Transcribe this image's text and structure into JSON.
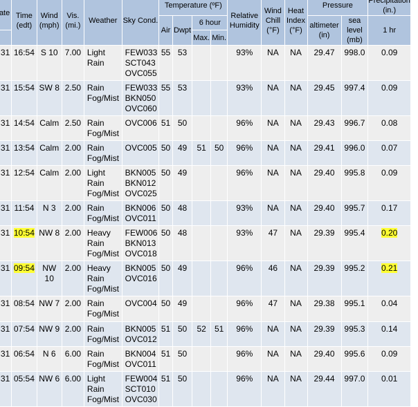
{
  "headers": {
    "date": "Date",
    "time": "Time (edt)",
    "wind": "Wind (mph)",
    "vis": "Vis. (mi.)",
    "weather": "Weather",
    "sky": "Sky Cond.",
    "temp": "Temperature (ºF)",
    "air": "Air",
    "dwpt": "Dwpt",
    "six_hour": "6 hour",
    "max": "Max.",
    "min": "Min.",
    "rh": "Relative Humidity",
    "wind_chill": "Wind Chill (°F)",
    "heat_index": "Heat Index (°F)",
    "pressure": "Pressure",
    "altimeter": "altimeter (in)",
    "sea_level": "sea level (mb)",
    "precip": "Precipitation (in.)",
    "one_hr": "1 hr"
  },
  "rows": [
    {
      "date": "31",
      "time": "16:54",
      "wind": "S 10",
      "vis": "7.00",
      "weather": [
        "Light",
        "Rain"
      ],
      "sky": [
        "FEW033",
        "SCT043",
        "OVC055"
      ],
      "air": "55",
      "dwpt": "53",
      "max": "",
      "min": "",
      "rh": "93%",
      "chill": "NA",
      "heat": "NA",
      "alt": "29.47",
      "sea": "998.0",
      "hr1": "0.09",
      "time_hl": false,
      "hr1_hl": false
    },
    {
      "date": "31",
      "time": "15:54",
      "wind": "SW 8",
      "vis": "2.50",
      "weather": [
        "Rain",
        "Fog/Mist"
      ],
      "sky": [
        "FEW033",
        "BKN050",
        "OVC060"
      ],
      "air": "55",
      "dwpt": "53",
      "max": "",
      "min": "",
      "rh": "93%",
      "chill": "NA",
      "heat": "NA",
      "alt": "29.45",
      "sea": "997.4",
      "hr1": "0.09",
      "time_hl": false,
      "hr1_hl": false
    },
    {
      "date": "31",
      "time": "14:54",
      "wind": "Calm",
      "vis": "2.50",
      "weather": [
        "Rain",
        "Fog/Mist"
      ],
      "sky": [
        "OVC006"
      ],
      "air": "51",
      "dwpt": "50",
      "max": "",
      "min": "",
      "rh": "96%",
      "chill": "NA",
      "heat": "NA",
      "alt": "29.43",
      "sea": "996.7",
      "hr1": "0.08",
      "time_hl": false,
      "hr1_hl": false
    },
    {
      "date": "31",
      "time": "13:54",
      "wind": "Calm",
      "vis": "2.00",
      "weather": [
        "Rain",
        "Fog/Mist"
      ],
      "sky": [
        "OVC005"
      ],
      "air": "50",
      "dwpt": "49",
      "max": "51",
      "min": "50",
      "rh": "96%",
      "chill": "NA",
      "heat": "NA",
      "alt": "29.41",
      "sea": "996.0",
      "hr1": "0.07",
      "time_hl": false,
      "hr1_hl": false
    },
    {
      "date": "31",
      "time": "12:54",
      "wind": "Calm",
      "vis": "2.00",
      "weather": [
        "Light",
        "Rain",
        "Fog/Mist"
      ],
      "sky": [
        "BKN005",
        "BKN012",
        "OVC025"
      ],
      "air": "50",
      "dwpt": "49",
      "max": "",
      "min": "",
      "rh": "96%",
      "chill": "NA",
      "heat": "NA",
      "alt": "29.40",
      "sea": "995.8",
      "hr1": "0.09",
      "time_hl": false,
      "hr1_hl": false
    },
    {
      "date": "31",
      "time": "11:54",
      "wind": "N 3",
      "vis": "2.00",
      "weather": [
        "Rain",
        "Fog/Mist"
      ],
      "sky": [
        "BKN006",
        "OVC011"
      ],
      "air": "50",
      "dwpt": "48",
      "max": "",
      "min": "",
      "rh": "93%",
      "chill": "NA",
      "heat": "NA",
      "alt": "29.40",
      "sea": "995.7",
      "hr1": "0.17",
      "time_hl": false,
      "hr1_hl": false
    },
    {
      "date": "31",
      "time": "10:54",
      "wind": "NW 8",
      "vis": "2.00",
      "weather": [
        "Heavy",
        "Rain",
        "Fog/Mist"
      ],
      "sky": [
        "FEW006",
        "BKN013",
        "OVC018"
      ],
      "air": "50",
      "dwpt": "48",
      "max": "",
      "min": "",
      "rh": "93%",
      "chill": "47",
      "heat": "NA",
      "alt": "29.39",
      "sea": "995.4",
      "hr1": "0.20",
      "time_hl": true,
      "hr1_hl": true
    },
    {
      "date": "31",
      "time": "09:54",
      "wind": "NW 10",
      "vis": "2.00",
      "weather": [
        "Heavy",
        "Rain",
        "Fog/Mist"
      ],
      "sky": [
        "BKN005",
        "OVC016"
      ],
      "air": "50",
      "dwpt": "49",
      "max": "",
      "min": "",
      "rh": "96%",
      "chill": "46",
      "heat": "NA",
      "alt": "29.39",
      "sea": "995.2",
      "hr1": "0.21",
      "time_hl": true,
      "hr1_hl": true
    },
    {
      "date": "31",
      "time": "08:54",
      "wind": "NW 7",
      "vis": "2.00",
      "weather": [
        "Rain",
        "Fog/Mist"
      ],
      "sky": [
        "OVC004"
      ],
      "air": "50",
      "dwpt": "49",
      "max": "",
      "min": "",
      "rh": "96%",
      "chill": "47",
      "heat": "NA",
      "alt": "29.38",
      "sea": "995.1",
      "hr1": "0.04",
      "time_hl": false,
      "hr1_hl": false
    },
    {
      "date": "31",
      "time": "07:54",
      "wind": "NW 9",
      "vis": "2.00",
      "weather": [
        "Rain",
        "Fog/Mist"
      ],
      "sky": [
        "BKN005",
        "OVC012"
      ],
      "air": "51",
      "dwpt": "50",
      "max": "52",
      "min": "51",
      "rh": "96%",
      "chill": "NA",
      "heat": "NA",
      "alt": "29.39",
      "sea": "995.3",
      "hr1": "0.14",
      "time_hl": false,
      "hr1_hl": false
    },
    {
      "date": "31",
      "time": "06:54",
      "wind": "N 6",
      "vis": "6.00",
      "weather": [
        "Rain",
        "Fog/Mist"
      ],
      "sky": [
        "BKN004",
        "OVC011"
      ],
      "air": "51",
      "dwpt": "50",
      "max": "",
      "min": "",
      "rh": "96%",
      "chill": "NA",
      "heat": "NA",
      "alt": "29.40",
      "sea": "995.6",
      "hr1": "0.09",
      "time_hl": false,
      "hr1_hl": false
    },
    {
      "date": "31",
      "time": "05:54",
      "wind": "NW 6",
      "vis": "6.00",
      "weather": [
        "Light",
        "Rain",
        "Fog/Mist"
      ],
      "sky": [
        "FEW004",
        "SCT010",
        "OVC030"
      ],
      "air": "51",
      "dwpt": "50",
      "max": "",
      "min": "",
      "rh": "96%",
      "chill": "NA",
      "heat": "NA",
      "alt": "29.44",
      "sea": "997.0",
      "hr1": "0.01",
      "time_hl": false,
      "hr1_hl": false
    }
  ]
}
